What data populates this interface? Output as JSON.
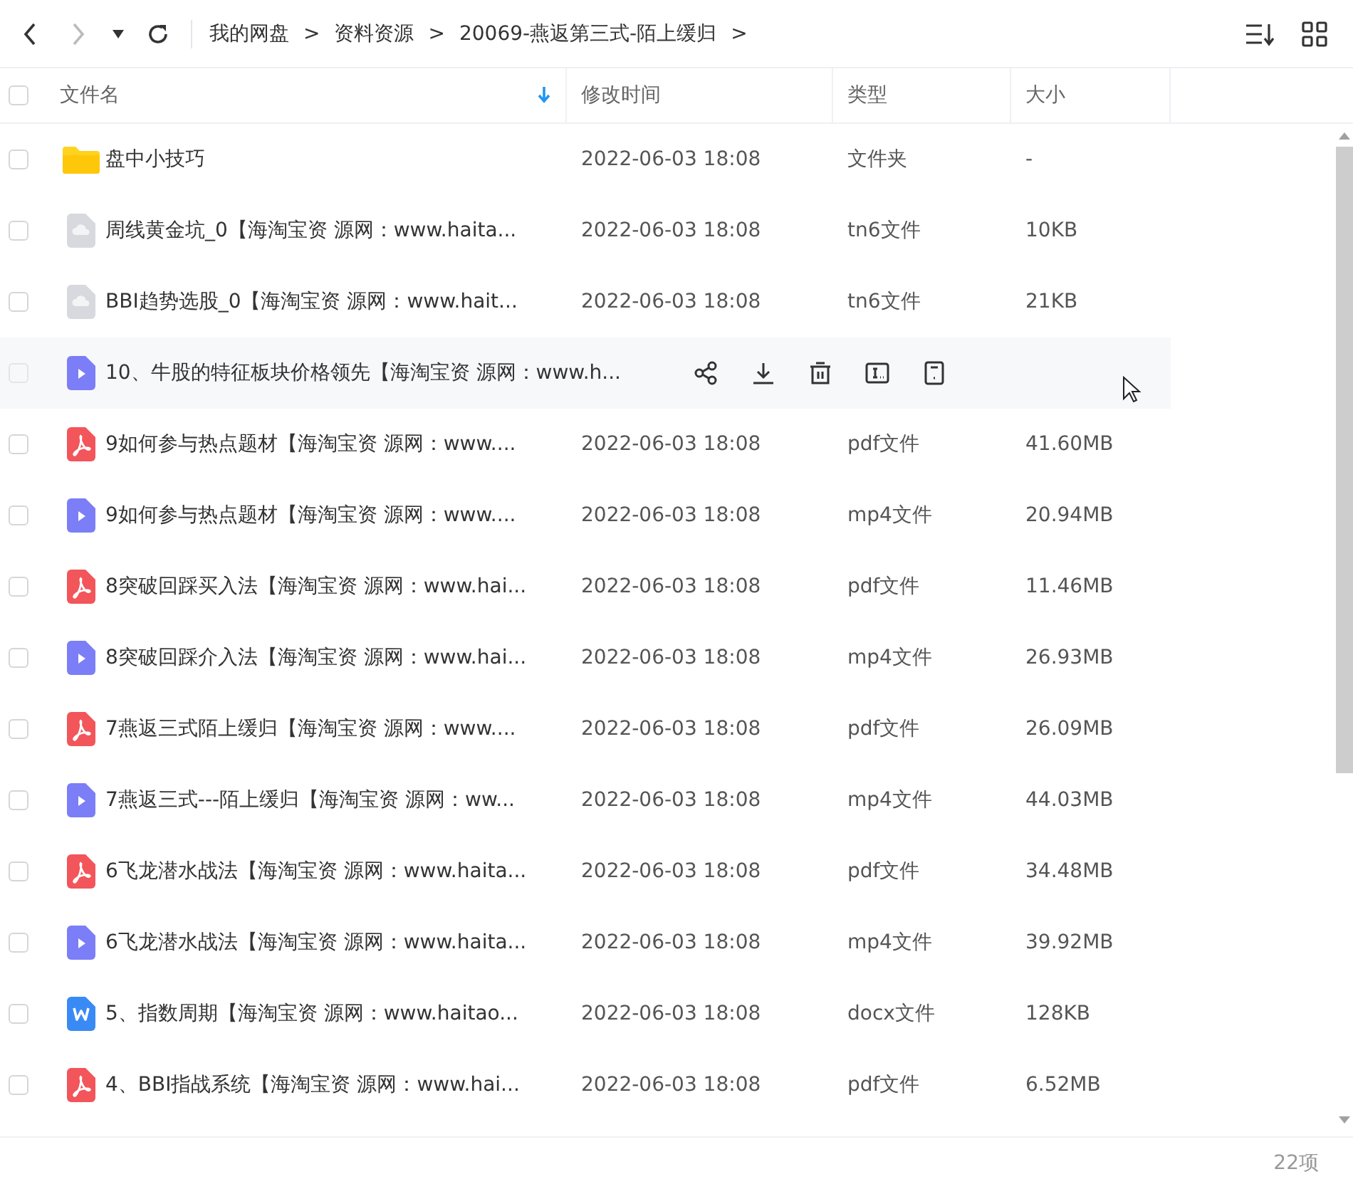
{
  "toolbar": {
    "breadcrumb": [
      "我的网盘",
      "资料资源",
      "20069-燕返第三式-陌上缓归"
    ],
    "separators": [
      ">",
      ">",
      ">"
    ]
  },
  "table": {
    "select_all": {
      "checked": false
    },
    "columns": [
      {
        "label": "文件名",
        "sorted": true
      },
      {
        "label": "修改时间",
        "sorted": false
      },
      {
        "label": "类型",
        "sorted": false
      },
      {
        "label": "大小",
        "sorted": false
      }
    ],
    "rows": [
      {
        "kind": "folder",
        "name": "盘中小技巧",
        "modified": "2022-06-03 18:08",
        "type": "文件夹",
        "size": "-",
        "checked": false,
        "hovered": false
      },
      {
        "kind": "cloud",
        "name": "周线黄金坑_0【海淘宝资 源网：www.haita...",
        "modified": "2022-06-03 18:08",
        "type": "tn6文件",
        "size": "10KB",
        "checked": false,
        "hovered": false
      },
      {
        "kind": "cloud",
        "name": "BBI趋势选股_0【海淘宝资 源网：www.hait...",
        "modified": "2022-06-03 18:08",
        "type": "tn6文件",
        "size": "21KB",
        "checked": false,
        "hovered": false
      },
      {
        "kind": "video",
        "name": "10、牛股的特征板块价格领先【海淘宝资 源网：www.h...",
        "checked": false,
        "hovered": true
      },
      {
        "kind": "pdf",
        "name": "9如何参与热点题材【海淘宝资 源网：www....",
        "modified": "2022-06-03 18:08",
        "type": "pdf文件",
        "size": "41.60MB",
        "checked": false,
        "hovered": false
      },
      {
        "kind": "video",
        "name": "9如何参与热点题材【海淘宝资 源网：www....",
        "modified": "2022-06-03 18:08",
        "type": "mp4文件",
        "size": "20.94MB",
        "checked": false,
        "hovered": false
      },
      {
        "kind": "pdf",
        "name": "8突破回踩买入法【海淘宝资 源网：www.hai...",
        "modified": "2022-06-03 18:08",
        "type": "pdf文件",
        "size": "11.46MB",
        "checked": false,
        "hovered": false
      },
      {
        "kind": "video",
        "name": "8突破回踩介入法【海淘宝资 源网：www.hai...",
        "modified": "2022-06-03 18:08",
        "type": "mp4文件",
        "size": "26.93MB",
        "checked": false,
        "hovered": false
      },
      {
        "kind": "pdf",
        "name": "7燕返三式陌上缓归【海淘宝资 源网：www....",
        "modified": "2022-06-03 18:08",
        "type": "pdf文件",
        "size": "26.09MB",
        "checked": false,
        "hovered": false
      },
      {
        "kind": "video",
        "name": "7燕返三式---陌上缓归【海淘宝资 源网：ww...",
        "modified": "2022-06-03 18:08",
        "type": "mp4文件",
        "size": "44.03MB",
        "checked": false,
        "hovered": false
      },
      {
        "kind": "pdf",
        "name": "6飞龙潜水战法【海淘宝资 源网：www.haita...",
        "modified": "2022-06-03 18:08",
        "type": "pdf文件",
        "size": "34.48MB",
        "checked": false,
        "hovered": false
      },
      {
        "kind": "video",
        "name": "6飞龙潜水战法【海淘宝资 源网：www.haita...",
        "modified": "2022-06-03 18:08",
        "type": "mp4文件",
        "size": "39.92MB",
        "checked": false,
        "hovered": false
      },
      {
        "kind": "word",
        "name": "5、指数周期【海淘宝资 源网：www.haitao...",
        "modified": "2022-06-03 18:08",
        "type": "docx文件",
        "size": "128KB",
        "checked": false,
        "hovered": false
      },
      {
        "kind": "pdf",
        "name": "4、BBI指战系统【海淘宝资 源网：www.hai...",
        "modified": "2022-06-03 18:08",
        "type": "pdf文件",
        "size": "6.52MB",
        "checked": false,
        "hovered": false
      }
    ]
  },
  "status_bar": {
    "count": "22项"
  }
}
